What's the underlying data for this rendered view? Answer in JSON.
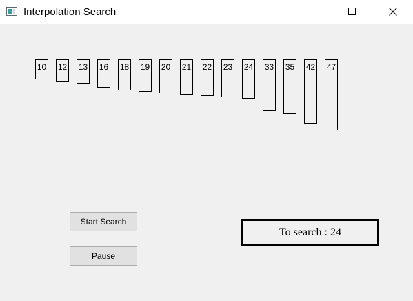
{
  "window": {
    "title": "Interpolation Search",
    "icon": "app-window-icon",
    "controls": [
      "minimize-icon",
      "maximize-icon",
      "close-icon"
    ]
  },
  "array": {
    "values": [
      "10",
      "12",
      "13",
      "16",
      "18",
      "19",
      "20",
      "21",
      "22",
      "23",
      "24",
      "33",
      "35",
      "42",
      "47"
    ]
  },
  "controls": {
    "start_label": "Start Search",
    "pause_label": "Pause"
  },
  "search": {
    "text": "To search : 24"
  }
}
